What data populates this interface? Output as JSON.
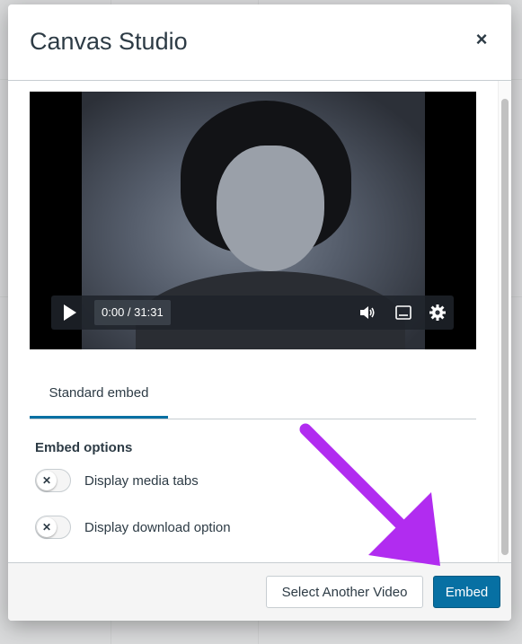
{
  "modal": {
    "title": "Canvas Studio",
    "close_label": "×"
  },
  "player": {
    "time": "0:00 / 31:31",
    "icons": [
      "play-icon",
      "volume-icon",
      "captions-icon",
      "gear-icon"
    ]
  },
  "tabs": [
    {
      "label": "Standard embed",
      "selected": true
    }
  ],
  "embed_options": {
    "title": "Embed options",
    "items": [
      {
        "label": "Display media tabs",
        "enabled": false
      },
      {
        "label": "Display download option",
        "enabled": false
      }
    ]
  },
  "footer": {
    "secondary_label": "Select Another Video",
    "primary_label": "Embed"
  },
  "colors": {
    "primary": "#0770a3",
    "annotation_arrow": "#b12cf0",
    "text": "#2d3b45"
  }
}
